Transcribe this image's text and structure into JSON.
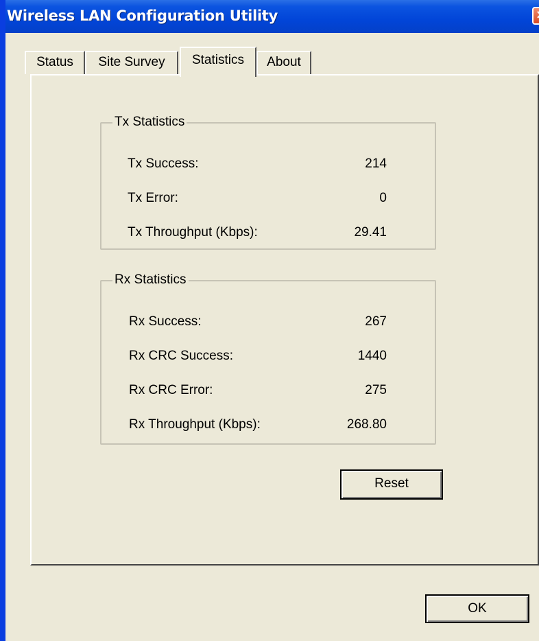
{
  "window": {
    "title": "Wireless LAN Configuration Utility",
    "close_glyph": "×",
    "colors": {
      "titlebar": "#0245d8",
      "face": "#ece9d8",
      "close": "#d84a23"
    }
  },
  "tabs": [
    {
      "label": "Status",
      "active": false
    },
    {
      "label": "Site Survey",
      "active": false
    },
    {
      "label": "Statistics",
      "active": true
    },
    {
      "label": "About",
      "active": false
    }
  ],
  "tx": {
    "title": "Tx Statistics",
    "rows": [
      {
        "label": "Tx Success:",
        "value": "214"
      },
      {
        "label": "Tx Error:",
        "value": "0"
      },
      {
        "label": "Tx Throughput (Kbps):",
        "value": "29.41"
      }
    ]
  },
  "rx": {
    "title": "Rx Statistics",
    "rows": [
      {
        "label": "Rx Success:",
        "value": "267"
      },
      {
        "label": "Rx CRC Success:",
        "value": "1440"
      },
      {
        "label": "Rx CRC Error:",
        "value": "275"
      },
      {
        "label": "Rx Throughput (Kbps):",
        "value": "268.80"
      }
    ]
  },
  "buttons": {
    "reset": "Reset",
    "ok": "OK"
  }
}
